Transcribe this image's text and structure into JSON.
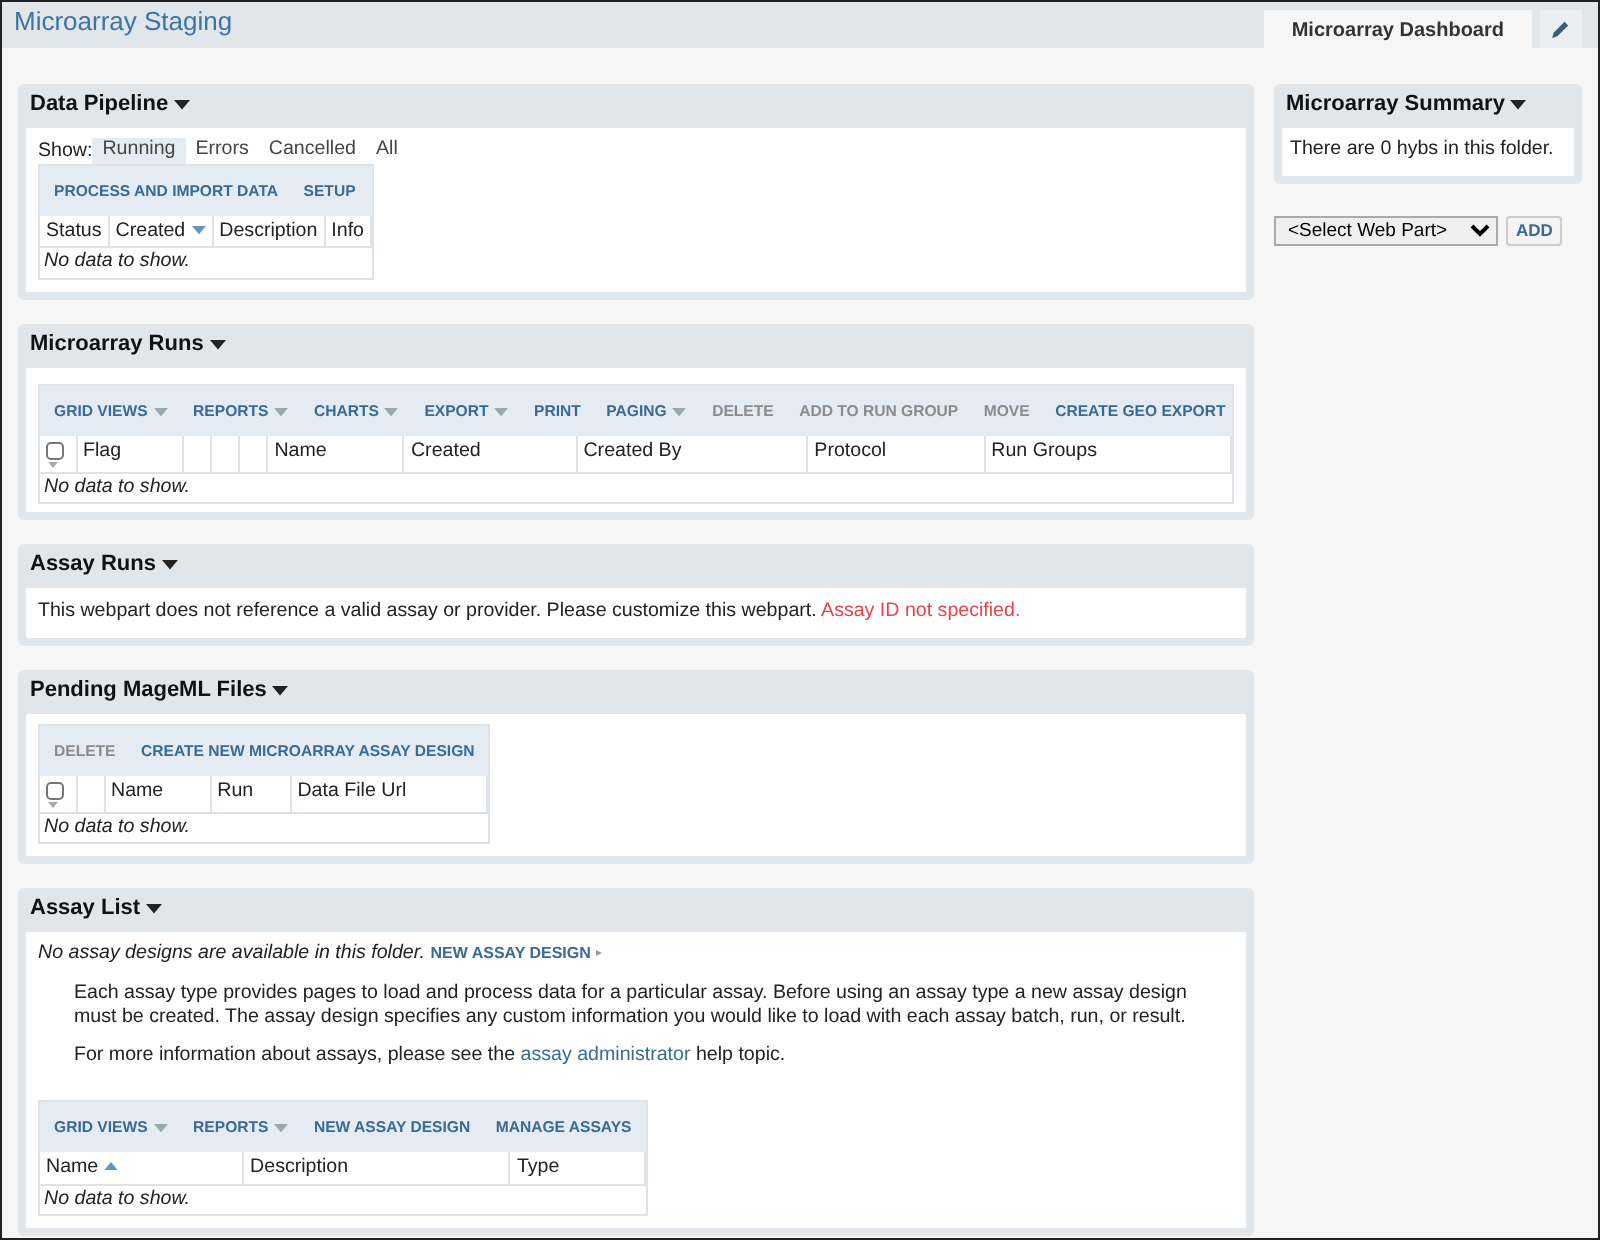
{
  "header": {
    "title": "Microarray Staging",
    "tabs": [
      {
        "label": "Microarray Dashboard",
        "selected": true
      }
    ]
  },
  "panels": [
    {
      "kind": "grid",
      "title": "Data Pipeline",
      "filters": {
        "label": "Show:",
        "options": [
          {
            "label": "Running",
            "selected": true
          },
          {
            "label": "Errors",
            "selected": false
          },
          {
            "label": "Cancelled",
            "selected": false
          },
          {
            "label": "All",
            "selected": false
          }
        ]
      },
      "toolbar": [
        {
          "label": "PROCESS AND IMPORT DATA",
          "menu": false,
          "disabled": false
        },
        {
          "label": "SETUP",
          "menu": false,
          "disabled": false
        }
      ],
      "columns": [
        {
          "kind": "text",
          "label": "Status",
          "sorted": false
        },
        {
          "kind": "text",
          "label": "Created",
          "sorted": true,
          "ascending": false
        },
        {
          "kind": "text",
          "label": "Description",
          "sorted": false
        },
        {
          "kind": "text",
          "label": "Info",
          "sorted": false
        }
      ],
      "empty": "No data to show."
    },
    {
      "kind": "grid",
      "title": "Microarray Runs",
      "toolbar": [
        {
          "label": "GRID VIEWS",
          "menu": true,
          "disabled": false
        },
        {
          "label": "REPORTS",
          "menu": true,
          "disabled": false
        },
        {
          "label": "CHARTS",
          "menu": true,
          "disabled": false
        },
        {
          "label": "EXPORT",
          "menu": true,
          "disabled": false
        },
        {
          "label": "PRINT",
          "menu": false,
          "disabled": false
        },
        {
          "label": "PAGING",
          "menu": true,
          "disabled": false
        },
        {
          "label": "DELETE",
          "menu": false,
          "disabled": true
        },
        {
          "label": "ADD TO RUN GROUP",
          "menu": false,
          "disabled": true
        },
        {
          "label": "MOVE",
          "menu": false,
          "disabled": true
        },
        {
          "label": "CREATE GEO EXPORT",
          "menu": false,
          "disabled": false
        }
      ],
      "columns": [
        {
          "kind": "checkbox",
          "checked": false
        },
        {
          "kind": "text",
          "label": "Flag"
        },
        {
          "kind": "blank"
        },
        {
          "kind": "blank"
        },
        {
          "kind": "blank"
        },
        {
          "kind": "text",
          "label": "Name"
        },
        {
          "kind": "text",
          "label": "Created"
        },
        {
          "kind": "text",
          "label": "Created By"
        },
        {
          "kind": "text",
          "label": "Protocol"
        },
        {
          "kind": "text",
          "label": "Run Groups"
        }
      ],
      "empty": "No data to show."
    },
    {
      "kind": "message",
      "title": "Assay Runs",
      "text": "This webpart does not reference a valid assay or provider. Please customize this webpart.",
      "error": "Assay ID not specified."
    },
    {
      "kind": "grid",
      "title": "Pending MageML Files",
      "toolbar": [
        {
          "label": "DELETE",
          "menu": false,
          "disabled": true
        },
        {
          "label": "CREATE NEW MICROARRAY ASSAY DESIGN",
          "menu": false,
          "disabled": false
        }
      ],
      "columns": [
        {
          "kind": "checkbox",
          "checked": false
        },
        {
          "kind": "blank"
        },
        {
          "kind": "text",
          "label": "Name"
        },
        {
          "kind": "text",
          "label": "Run"
        },
        {
          "kind": "text",
          "label": "Data File Url"
        }
      ],
      "empty": "No data to show."
    },
    {
      "kind": "assay_list",
      "title": "Assay List",
      "notice": "No assay designs are available in this folder.",
      "notice_link": "NEW ASSAY DESIGN",
      "paragraph": "Each assay type provides pages to load and process data for a particular assay. Before using an assay type a new assay design must be created. The assay design specifies any custom information you would like to load with each assay batch, run, or result.",
      "help": {
        "before": "For more information about assays, please see the",
        "link": "assay administrator",
        "after": "help topic."
      },
      "toolbar": [
        {
          "label": "GRID VIEWS",
          "menu": true,
          "disabled": false
        },
        {
          "label": "REPORTS",
          "menu": true,
          "disabled": false
        },
        {
          "label": "NEW ASSAY DESIGN",
          "menu": false,
          "disabled": false
        },
        {
          "label": "MANAGE ASSAYS",
          "menu": false,
          "disabled": false
        }
      ],
      "columns": [
        {
          "kind": "text",
          "label": "Name",
          "sorted": true,
          "ascending": true
        },
        {
          "kind": "text",
          "label": "Description",
          "sorted": false
        },
        {
          "kind": "text",
          "label": "Type",
          "sorted": false
        }
      ],
      "empty": "No data to show."
    }
  ],
  "sidebar": {
    "title": "Microarray Summary",
    "text": "There are 0 hybs in this folder.",
    "web_part_select": {
      "value": "<Select Web Part>"
    },
    "add_button": "ADD"
  }
}
